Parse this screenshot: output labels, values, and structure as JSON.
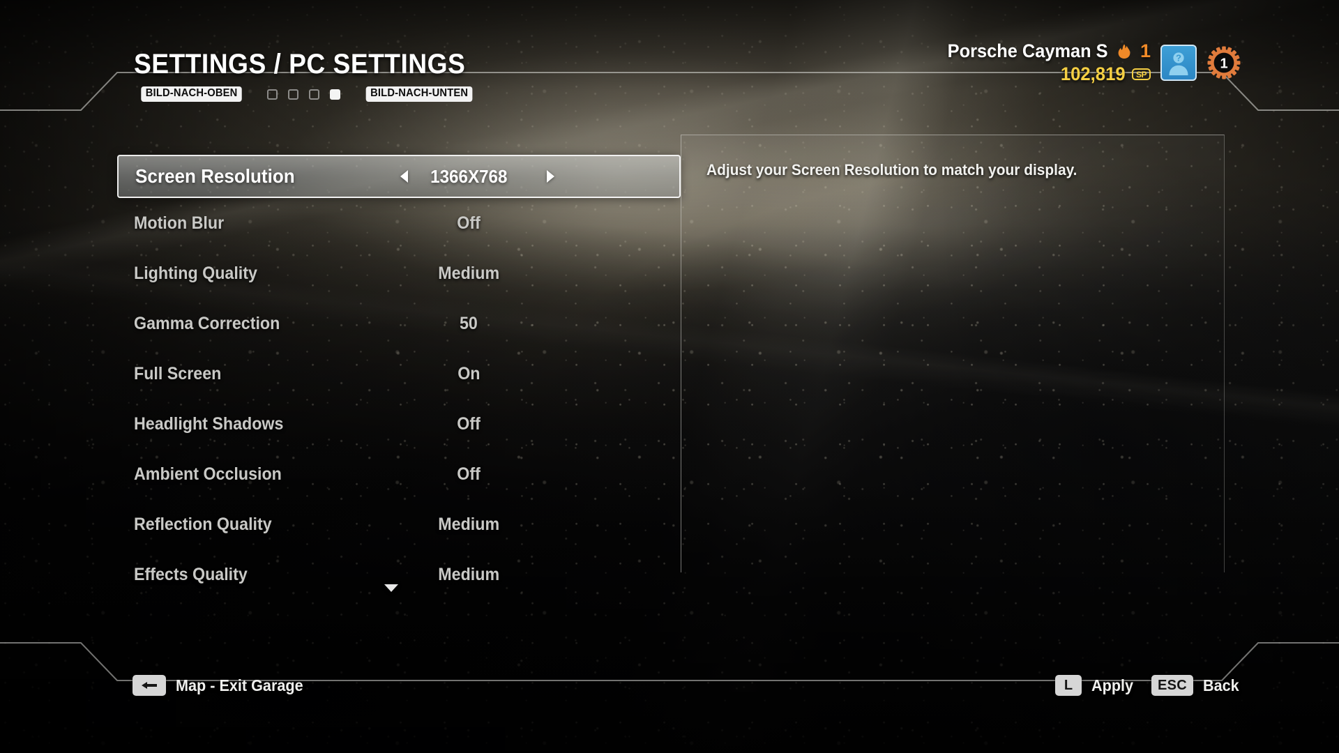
{
  "header": {
    "title": "SETTINGS / PC SETTINGS",
    "page_up_key": "BILD-NACH-OBEN",
    "page_down_key": "BILD-NACH-UNTEN",
    "tab_count": 4,
    "active_tab_index": 3
  },
  "hud": {
    "car_name": "Porsche Cayman S",
    "heat_level": "1",
    "heat_icon": "flame-icon",
    "currency_value": "102,819",
    "currency_badge": "SP",
    "avatar_icon": "unknown-player-avatar-icon",
    "level_badge": "1",
    "level_icon": "gear-icon",
    "colors": {
      "heat": "#f08a28",
      "currency": "#f5cf43",
      "avatar": "#2b86c4",
      "gear": "#e07b3c"
    }
  },
  "settings": {
    "rows": [
      {
        "label": "Screen Resolution",
        "value": "1366X768",
        "selected": true
      },
      {
        "label": "Motion Blur",
        "value": "Off",
        "selected": false
      },
      {
        "label": "Lighting Quality",
        "value": "Medium",
        "selected": false
      },
      {
        "label": "Gamma Correction",
        "value": "50",
        "selected": false
      },
      {
        "label": "Full Screen",
        "value": "On",
        "selected": false
      },
      {
        "label": "Headlight Shadows",
        "value": "Off",
        "selected": false
      },
      {
        "label": "Ambient Occlusion",
        "value": "Off",
        "selected": false
      },
      {
        "label": "Reflection Quality",
        "value": "Medium",
        "selected": false
      },
      {
        "label": "Effects Quality",
        "value": "Medium",
        "selected": false
      }
    ],
    "scroll_down_icon": "chevron-down-icon"
  },
  "description": {
    "text": "Adjust your Screen Resolution to match your display."
  },
  "footer": {
    "left_hint": {
      "key": "backspace-key-icon",
      "label": "Map - Exit Garage"
    },
    "right_hints": [
      {
        "key": "L",
        "label": "Apply"
      },
      {
        "key": "ESC",
        "label": "Back"
      }
    ]
  }
}
